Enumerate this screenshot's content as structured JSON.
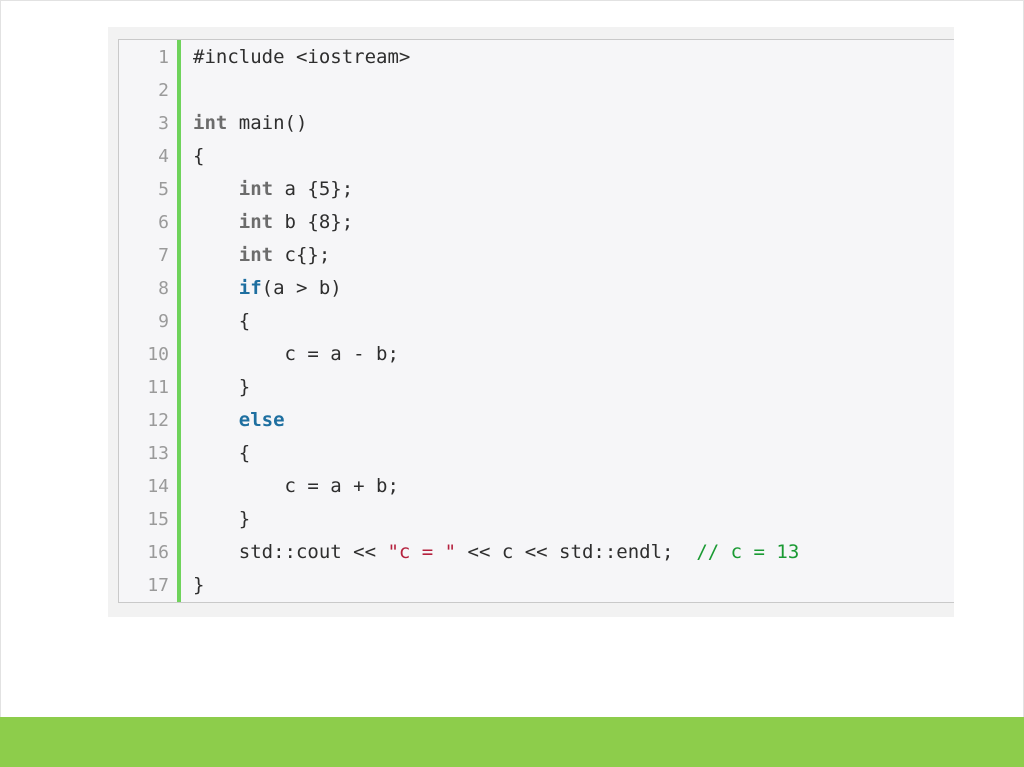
{
  "colors": {
    "background": "#ffffff",
    "code_panel": "#f6f6f8",
    "gutter_accent": "#6fd35b",
    "bottom_bar": "#8dcd4b",
    "keyword": "#1e6fa0",
    "type": "#6c6c6c",
    "string": "#b5213e",
    "comment": "#1a9a33"
  },
  "code": {
    "language": "C++",
    "lines": [
      {
        "number": "1",
        "tokens": [
          {
            "text": "#include <iostream>",
            "kind": "plain"
          }
        ]
      },
      {
        "number": "2",
        "tokens": []
      },
      {
        "number": "3",
        "tokens": [
          {
            "text": "int",
            "kind": "type"
          },
          {
            "text": " main()",
            "kind": "plain"
          }
        ]
      },
      {
        "number": "4",
        "tokens": [
          {
            "text": "{",
            "kind": "plain"
          }
        ]
      },
      {
        "number": "5",
        "tokens": [
          {
            "text": "    ",
            "kind": "plain"
          },
          {
            "text": "int",
            "kind": "type"
          },
          {
            "text": " a {5};",
            "kind": "plain"
          }
        ]
      },
      {
        "number": "6",
        "tokens": [
          {
            "text": "    ",
            "kind": "plain"
          },
          {
            "text": "int",
            "kind": "type"
          },
          {
            "text": " b {8};",
            "kind": "plain"
          }
        ]
      },
      {
        "number": "7",
        "tokens": [
          {
            "text": "    ",
            "kind": "plain"
          },
          {
            "text": "int",
            "kind": "type"
          },
          {
            "text": " c{};",
            "kind": "plain"
          }
        ]
      },
      {
        "number": "8",
        "tokens": [
          {
            "text": "    ",
            "kind": "plain"
          },
          {
            "text": "if",
            "kind": "keyword"
          },
          {
            "text": "(a > b)",
            "kind": "plain"
          }
        ]
      },
      {
        "number": "9",
        "tokens": [
          {
            "text": "    {",
            "kind": "plain"
          }
        ]
      },
      {
        "number": "10",
        "tokens": [
          {
            "text": "        c = a - b;",
            "kind": "plain"
          }
        ]
      },
      {
        "number": "11",
        "tokens": [
          {
            "text": "    }",
            "kind": "plain"
          }
        ]
      },
      {
        "number": "12",
        "tokens": [
          {
            "text": "    ",
            "kind": "plain"
          },
          {
            "text": "else",
            "kind": "keyword"
          }
        ]
      },
      {
        "number": "13",
        "tokens": [
          {
            "text": "    {",
            "kind": "plain"
          }
        ]
      },
      {
        "number": "14",
        "tokens": [
          {
            "text": "        c = a + b;",
            "kind": "plain"
          }
        ]
      },
      {
        "number": "15",
        "tokens": [
          {
            "text": "    }",
            "kind": "plain"
          }
        ]
      },
      {
        "number": "16",
        "tokens": [
          {
            "text": "    std::cout << ",
            "kind": "plain"
          },
          {
            "text": "\"c = \"",
            "kind": "string"
          },
          {
            "text": " << c << std::endl;  ",
            "kind": "plain"
          },
          {
            "text": "// c = 13",
            "kind": "comment"
          }
        ]
      },
      {
        "number": "17",
        "tokens": [
          {
            "text": "}",
            "kind": "plain"
          }
        ]
      }
    ]
  }
}
